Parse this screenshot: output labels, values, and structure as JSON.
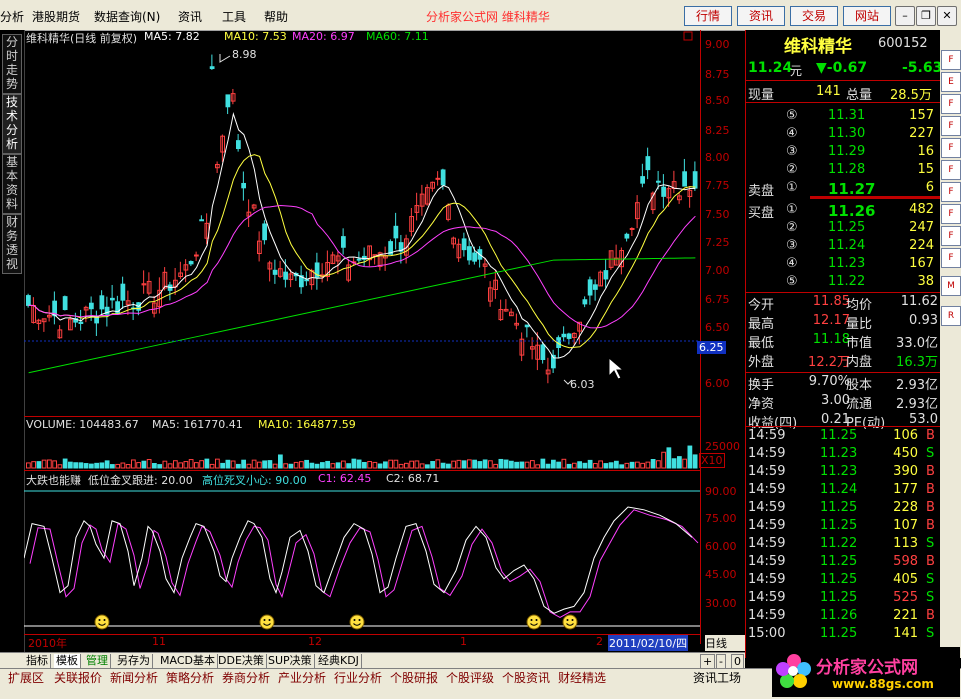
{
  "menubar": {
    "items": [
      "分析",
      "港股期货",
      "数据查询(N)",
      "资讯",
      "工具",
      "帮助"
    ],
    "brand": "分析家公式网 维科精华",
    "buttons": [
      "行情",
      "资讯",
      "交易",
      "网站"
    ]
  },
  "left_tabs": [
    "分时走势",
    "技术分析",
    "基本资料",
    "财务透视"
  ],
  "chart_header": {
    "name": "维科精华(日线 前复权)",
    "ma5": "MA5: 7.82",
    "ma10": "MA10: 7.53",
    "ma20": "MA20: 6.97",
    "ma60": "MA60: 7.11",
    "high_marker": "8.98",
    "low_marker": "6.03",
    "current_price_tag": "6.25"
  },
  "price_axis": [
    "9.00",
    "8.75",
    "8.50",
    "8.25",
    "8.00",
    "7.75",
    "7.50",
    "7.25",
    "7.00",
    "6.75",
    "6.50",
    "6.25",
    "6.00"
  ],
  "volume_header": {
    "volume": "VOLUME: 104483.67",
    "ma5": "MA5: 161770.41",
    "ma10": "MA10: 164877.59",
    "axis_top": "25000",
    "unit": "X10"
  },
  "indicator_header": {
    "title": "大跌也能赚",
    "low_cross": "低位金叉跟进: 20.00",
    "high_cross": "高位死叉小心: 90.00",
    "c1": "C1: 62.45",
    "c2": "C2: 68.71"
  },
  "indicator_axis": [
    "90.00",
    "75.00",
    "60.00",
    "45.00",
    "30.00"
  ],
  "date_axis": {
    "labels": [
      "2010年",
      "11",
      "12",
      "1",
      "2"
    ],
    "current": "2011/02/10/四",
    "period": "日线"
  },
  "info": {
    "stock_name": "维科精华",
    "code": "600152",
    "price": "11.24",
    "price_unit": "元",
    "change": "▼-0.67",
    "change_pct": "-5.63",
    "volume_now_label": "现量",
    "volume_now": "141",
    "volume_total_label": "总量",
    "volume_total": "28.5万",
    "sell_label": "卖盘",
    "buy_label": "买盘",
    "sells": [
      {
        "level": "⑤",
        "price": "11.31",
        "vol": "157"
      },
      {
        "level": "④",
        "price": "11.30",
        "vol": "227"
      },
      {
        "level": "③",
        "price": "11.29",
        "vol": "16"
      },
      {
        "level": "②",
        "price": "11.28",
        "vol": "15"
      },
      {
        "level": "①",
        "price": "11.27",
        "vol": "6"
      }
    ],
    "buys": [
      {
        "level": "①",
        "price": "11.26",
        "vol": "482"
      },
      {
        "level": "②",
        "price": "11.25",
        "vol": "247"
      },
      {
        "level": "③",
        "price": "11.24",
        "vol": "224"
      },
      {
        "level": "④",
        "price": "11.23",
        "vol": "167"
      },
      {
        "level": "⑤",
        "price": "11.22",
        "vol": "38"
      }
    ],
    "stats": [
      {
        "l1": "今开",
        "v1": "11.85",
        "l2": "均价",
        "v2": "11.62"
      },
      {
        "l1": "最高",
        "v1": "12.17",
        "l2": "量比",
        "v2": "0.93"
      },
      {
        "l1": "最低",
        "v1": "11.18",
        "l2": "市值",
        "v2": "33.0亿"
      },
      {
        "l1": "外盘",
        "v1": "12.2万",
        "l2": "内盘",
        "v2": "16.3万"
      },
      {
        "l1": "换手",
        "v1": "9.70%",
        "l2": "股本",
        "v2": "2.93亿"
      },
      {
        "l1": "净资",
        "v1": "3.00",
        "l2": "流通",
        "v2": "2.93亿"
      },
      {
        "l1": "收益(四)",
        "v1": "0.21",
        "l2": "PE(动)",
        "v2": "53.0"
      }
    ],
    "ticks": [
      {
        "time": "14:59",
        "price": "11.25",
        "vol": "106",
        "side": "B"
      },
      {
        "time": "14:59",
        "price": "11.23",
        "vol": "450",
        "side": "S"
      },
      {
        "time": "14:59",
        "price": "11.23",
        "vol": "390",
        "side": "B"
      },
      {
        "time": "14:59",
        "price": "11.24",
        "vol": "177",
        "side": "B"
      },
      {
        "time": "14:59",
        "price": "11.25",
        "vol": "228",
        "side": "B"
      },
      {
        "time": "14:59",
        "price": "11.25",
        "vol": "107",
        "side": "B"
      },
      {
        "time": "14:59",
        "price": "11.22",
        "vol": "113",
        "side": "S"
      },
      {
        "time": "14:59",
        "price": "11.25",
        "vol": "598",
        "side": "B"
      },
      {
        "time": "14:59",
        "price": "11.25",
        "vol": "405",
        "side": "S"
      },
      {
        "time": "14:59",
        "price": "11.25",
        "vol": "525",
        "side": "S"
      },
      {
        "time": "14:59",
        "price": "11.26",
        "vol": "221",
        "side": "B"
      },
      {
        "time": "15:00",
        "price": "11.25",
        "vol": "141",
        "side": "S"
      }
    ]
  },
  "bottom_tabs": [
    "指标",
    "模板",
    "管理",
    "另存为",
    "MACD基本",
    "DDE决策",
    "SUP决策",
    "经典KDJ"
  ],
  "bottom_controls": [
    "+",
    "-",
    "0"
  ],
  "status_tabs": [
    "扩展区",
    "关联报价",
    "新闻分析",
    "策略分析",
    "券商分析",
    "产业分析",
    "行业分析",
    "个股研报",
    "个股评级",
    "个股资讯",
    "财经精选"
  ],
  "status_right": "资讯工场",
  "watermark": {
    "text": "分析家公式网",
    "url": "www.88gs.com"
  },
  "colors": {
    "up": "#ff4040",
    "down": "#40e0e0",
    "ma5": "#ffffff",
    "ma10": "#ffff40",
    "ma20": "#ff40ff",
    "ma60": "#00e000"
  }
}
